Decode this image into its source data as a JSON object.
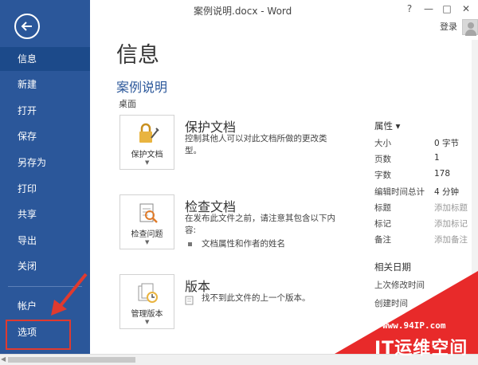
{
  "window": {
    "title": "案例说明.docx - Word",
    "help_label": "?",
    "minimize_label": "—",
    "restore_label": "□",
    "close_label": "✕",
    "login_label": "登录"
  },
  "sidebar": {
    "items": [
      {
        "label": "信息"
      },
      {
        "label": "新建"
      },
      {
        "label": "打开"
      },
      {
        "label": "保存"
      },
      {
        "label": "另存为"
      },
      {
        "label": "打印"
      },
      {
        "label": "共享"
      },
      {
        "label": "导出"
      },
      {
        "label": "关闭"
      },
      {
        "label": "帐户"
      },
      {
        "label": "选项"
      }
    ]
  },
  "main": {
    "page_title": "信息",
    "doc_name": "案例说明",
    "doc_path": "桌面",
    "cards": [
      {
        "button_label": "保护文档",
        "title": "保护文档",
        "desc": "控制其他人可以对此文档所做的更改类型。"
      },
      {
        "button_label": "检查问题",
        "title": "检查文档",
        "desc": "在发布此文件之前，请注意其包含以下内容:",
        "bullet": "文档属性和作者的姓名"
      },
      {
        "button_label": "管理版本",
        "title": "版本",
        "desc": "找不到此文件的上一个版本。"
      }
    ]
  },
  "properties": {
    "header": "属性 ▾",
    "rows": [
      {
        "key": "大小",
        "value": "0 字节"
      },
      {
        "key": "页数",
        "value": "1"
      },
      {
        "key": "字数",
        "value": "178"
      },
      {
        "key": "编辑时间总计",
        "value": "4 分钟"
      },
      {
        "key": "标题",
        "value": "添加标题"
      },
      {
        "key": "标记",
        "value": "添加标记"
      },
      {
        "key": "备注",
        "value": "添加备注"
      }
    ],
    "related_header": "相关日期",
    "related_rows": [
      {
        "key": "上次修改时间"
      },
      {
        "key": "创建时间"
      }
    ]
  },
  "watermark": {
    "url": "www.94IP.com",
    "brand": "IT运维空间"
  }
}
